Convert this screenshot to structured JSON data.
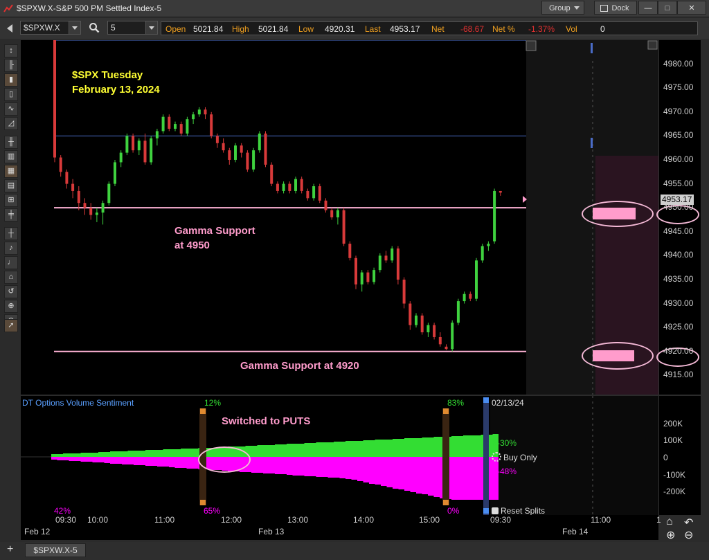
{
  "window": {
    "title": "$SPXW.X-S&P 500 PM Settled Index-5",
    "group_label": "Group",
    "dock_label": "Dock",
    "min_glyph": "—",
    "max_glyph": "□",
    "close_glyph": "✕"
  },
  "toolbar": {
    "symbol": "$SPXW.X",
    "interval": "5",
    "quote": {
      "open_label": "Open",
      "open": "5021.84",
      "high_label": "High",
      "high": "5021.84",
      "low_label": "Low",
      "low": "4920.31",
      "last_label": "Last",
      "last": "4953.17",
      "net_label": "Net",
      "net": "-68.67",
      "netpct_label": "Net %",
      "netpct": "-1.37%",
      "vol_label": "Vol",
      "vol": "0"
    }
  },
  "annotations": {
    "title_line1": "$SPX Tuesday",
    "title_line2": "February 13, 2024",
    "gamma1_line1": "Gamma Support",
    "gamma1_line2": "at 4950",
    "gamma2": "Gamma Support at 4920",
    "switched": "Switched to PUTS"
  },
  "price_scale": {
    "ticks": [
      "4980.00",
      "4975.00",
      "4970.00",
      "4965.00",
      "4960.00",
      "4955.00",
      "4950.00",
      "4945.00",
      "4940.00",
      "4935.00",
      "4930.00",
      "4925.00",
      "4920.00",
      "4915.00"
    ],
    "last_marker": "4953.17"
  },
  "indicator": {
    "title": "DT Options Volume Sentiment",
    "pct_top_left": "12%",
    "pct_top_right": "83%",
    "pct_bot_left": "42%",
    "pct_bot_mid": "65%",
    "pct_bot_right": "0%",
    "date": "02/13/24",
    "b_pos": "B-30%",
    "b_neg": "B-48%",
    "buy_only": "Buy Only",
    "reset_splits": "Reset Splits",
    "ticks": [
      "200K",
      "100K",
      "0",
      "-100K",
      "-200K"
    ]
  },
  "time_axis": {
    "times": [
      "09:30",
      "10:00",
      "11:00",
      "12:00",
      "13:00",
      "14:00",
      "15:00",
      "09:30",
      "11:00",
      "1"
    ],
    "dates": [
      "Feb 12",
      "Feb 13",
      "Feb 14"
    ]
  },
  "bottom": {
    "tab_label": "$SPXW.X-5",
    "add_glyph": "+"
  },
  "colors": {
    "up": "#3fd23f",
    "down": "#d83a3a",
    "gamma_line": "#ffb3d6",
    "blue_line": "#4a6cc8",
    "annotation_yellow": "#ffff33",
    "annotation_pink": "#ff9ccc",
    "magenta": "#ff00ff",
    "green": "#33dd33"
  },
  "chart_data": {
    "type": "candlestick",
    "symbol": "$SPXW.X",
    "interval_minutes": 5,
    "y_range": [
      4911,
      4985
    ],
    "levels": [
      {
        "label": "Gamma Support at 4950",
        "value": 4950
      },
      {
        "label": "Gamma Support at 4920",
        "value": 4920
      }
    ],
    "ohlc": [
      [
        5021.84,
        5021.84,
        4959.5,
        4960.5
      ],
      [
        4960.5,
        4961.0,
        4956.5,
        4957.5
      ],
      [
        4957.5,
        4958.0,
        4954.0,
        4955.0
      ],
      [
        4955.0,
        4956.0,
        4952.0,
        4953.5
      ],
      [
        4953.5,
        4954.5,
        4949.5,
        4951.0
      ],
      [
        4951.0,
        4952.0,
        4948.5,
        4950.0
      ],
      [
        4950.0,
        4951.0,
        4947.5,
        4948.5
      ],
      [
        4948.5,
        4950.0,
        4947.0,
        4949.0
      ],
      [
        4949.0,
        4951.5,
        4946.5,
        4951.0
      ],
      [
        4951.0,
        4955.5,
        4950.5,
        4955.0
      ],
      [
        4955.0,
        4960.0,
        4954.5,
        4959.5
      ],
      [
        4959.5,
        4962.0,
        4958.5,
        4961.5
      ],
      [
        4961.5,
        4965.5,
        4961.0,
        4965.0
      ],
      [
        4965.0,
        4965.5,
        4961.5,
        4962.0
      ],
      [
        4962.0,
        4964.5,
        4961.0,
        4964.0
      ],
      [
        4964.0,
        4965.5,
        4959.0,
        4959.5
      ],
      [
        4959.5,
        4965.0,
        4959.0,
        4964.5
      ],
      [
        4964.5,
        4966.5,
        4963.0,
        4966.0
      ],
      [
        4966.0,
        4969.5,
        4965.5,
        4969.0
      ],
      [
        4969.0,
        4969.5,
        4966.0,
        4966.5
      ],
      [
        4966.5,
        4968.0,
        4966.0,
        4967.5
      ],
      [
        4967.5,
        4968.0,
        4965.0,
        4965.5
      ],
      [
        4965.5,
        4969.0,
        4965.0,
        4968.5
      ],
      [
        4968.5,
        4970.0,
        4967.5,
        4969.5
      ],
      [
        4969.5,
        4971.0,
        4969.0,
        4970.5
      ],
      [
        4970.5,
        4971.0,
        4968.5,
        4969.5
      ],
      [
        4969.5,
        4970.0,
        4964.5,
        4965.0
      ],
      [
        4965.0,
        4965.5,
        4962.5,
        4963.5
      ],
      [
        4963.5,
        4964.5,
        4961.5,
        4962.0
      ],
      [
        4962.0,
        4962.5,
        4959.0,
        4960.0
      ],
      [
        4960.0,
        4963.5,
        4959.5,
        4963.0
      ],
      [
        4963.0,
        4963.5,
        4960.5,
        4961.5
      ],
      [
        4961.5,
        4962.0,
        4957.5,
        4958.0
      ],
      [
        4958.0,
        4962.5,
        4957.5,
        4962.0
      ],
      [
        4962.0,
        4966.0,
        4961.5,
        4965.5
      ],
      [
        4965.5,
        4966.0,
        4958.5,
        4959.0
      ],
      [
        4959.0,
        4959.5,
        4954.5,
        4955.0
      ],
      [
        4955.0,
        4955.5,
        4953.0,
        4953.5
      ],
      [
        4953.5,
        4955.5,
        4953.0,
        4955.0
      ],
      [
        4955.0,
        4955.5,
        4953.0,
        4953.5
      ],
      [
        4953.5,
        4956.5,
        4953.0,
        4956.0
      ],
      [
        4956.0,
        4956.5,
        4953.0,
        4953.5
      ],
      [
        4953.5,
        4954.0,
        4951.5,
        4952.0
      ],
      [
        4952.0,
        4955.0,
        4951.5,
        4954.5
      ],
      [
        4954.5,
        4955.0,
        4951.0,
        4951.5
      ],
      [
        4951.5,
        4952.0,
        4949.0,
        4949.5
      ],
      [
        4949.5,
        4950.0,
        4947.5,
        4948.0
      ],
      [
        4948.0,
        4950.0,
        4946.5,
        4949.5
      ],
      [
        4949.5,
        4950.0,
        4942.0,
        4942.5
      ],
      [
        4942.5,
        4943.0,
        4939.0,
        4939.5
      ],
      [
        4939.5,
        4940.0,
        4933.0,
        4934.0
      ],
      [
        4934.0,
        4937.0,
        4932.5,
        4936.5
      ],
      [
        4936.5,
        4937.0,
        4934.0,
        4934.5
      ],
      [
        4934.5,
        4937.5,
        4934.0,
        4937.0
      ],
      [
        4937.0,
        4940.5,
        4936.5,
        4940.0
      ],
      [
        4940.0,
        4941.0,
        4938.5,
        4939.0
      ],
      [
        4939.0,
        4942.0,
        4938.5,
        4941.5
      ],
      [
        4941.5,
        4942.0,
        4934.0,
        4935.0
      ],
      [
        4935.0,
        4935.5,
        4929.0,
        4930.0
      ],
      [
        4930.0,
        4930.5,
        4924.5,
        4925.5
      ],
      [
        4925.5,
        4928.0,
        4925.0,
        4927.5
      ],
      [
        4927.5,
        4928.0,
        4923.5,
        4924.0
      ],
      [
        4924.0,
        4926.0,
        4923.0,
        4925.5
      ],
      [
        4925.5,
        4926.0,
        4922.5,
        4923.0
      ],
      [
        4923.0,
        4924.0,
        4921.0,
        4921.5
      ],
      [
        4921.0,
        4921.5,
        4920.31,
        4920.5
      ],
      [
        4920.5,
        4926.5,
        4920.0,
        4926.0
      ],
      [
        4926.0,
        4931.0,
        4925.5,
        4930.5
      ],
      [
        4930.5,
        4932.5,
        4930.0,
        4932.0
      ],
      [
        4932.0,
        4932.5,
        4930.5,
        4931.0
      ],
      [
        4931.0,
        4939.5,
        4930.5,
        4939.0
      ],
      [
        4939.0,
        4942.5,
        4938.5,
        4942.0
      ],
      [
        4942.0,
        4943.0,
        4941.0,
        4942.5
      ],
      [
        4943.0,
        4954.0,
        4942.5,
        4953.5
      ],
      [
        4953.5,
        4953.5,
        4952.5,
        4953.17
      ]
    ]
  }
}
